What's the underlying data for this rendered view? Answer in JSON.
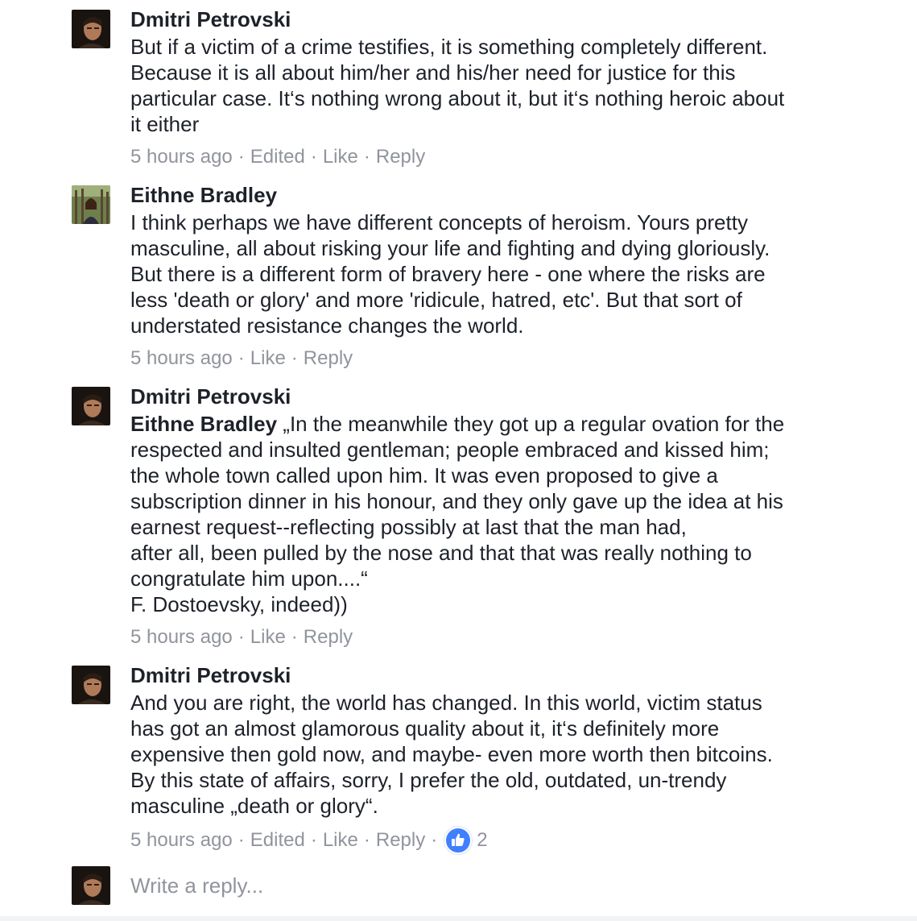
{
  "comments": [
    {
      "author": "Dmitri Petrovski",
      "text": "But if a victim of a crime testifies, it is something completely different.\nBecause it is all about him/her and his/her need for justice for this\nparticular case. It‘s nothing wrong about it, but it‘s nothing heroic about\nit either",
      "time": "5 hours ago",
      "edited": "Edited",
      "like": "Like",
      "reply": "Reply"
    },
    {
      "author": "Eithne Bradley",
      "text": "I think perhaps we have different concepts of heroism. Yours pretty\nmasculine, all about risking your life and fighting and dying gloriously.\nBut there is a different form of bravery here - one where the risks are\nless 'death or glory' and more 'ridicule, hatred, etc'. But that sort of\nunderstated resistance changes the world.",
      "time": "5 hours ago",
      "like": "Like",
      "reply": "Reply"
    },
    {
      "author": "Dmitri Petrovski",
      "mention": "Eithne Bradley",
      "text": " „In the meanwhile they got up a regular ovation for the\nrespected and insulted gentleman; people embraced and kissed him;\nthe whole town called upon him. It was even proposed to give a\nsubscription dinner in his honour, and they only gave up the idea at his\nearnest request--reflecting possibly at last that the man had,\nafter all, been pulled by the nose and that that was really nothing to\ncongratulate him upon....“\nF. Dostoevsky, indeed))",
      "time": "5 hours ago",
      "like": "Like",
      "reply": "Reply"
    },
    {
      "author": "Dmitri Petrovski",
      "text": "And you are right, the world has changed. In this world, victim status\nhas got an almost glamorous quality about it, it‘s definitely more\nexpensive then gold now, and maybe- even more worth then bitcoins.\nBy this state of affairs, sorry, I prefer the old, outdated, un-trendy\nmasculine „death or glory“.",
      "time": "5 hours ago",
      "edited": "Edited",
      "like": "Like",
      "reply": "Reply",
      "reaction_icon": "thumbs-up-icon",
      "reaction_count": "2"
    }
  ],
  "reply_box": {
    "placeholder": "Write a reply..."
  },
  "separator": "·",
  "colors": {
    "text": "#1d2129",
    "meta": "#90949c",
    "like_blue": "#4080ff"
  }
}
